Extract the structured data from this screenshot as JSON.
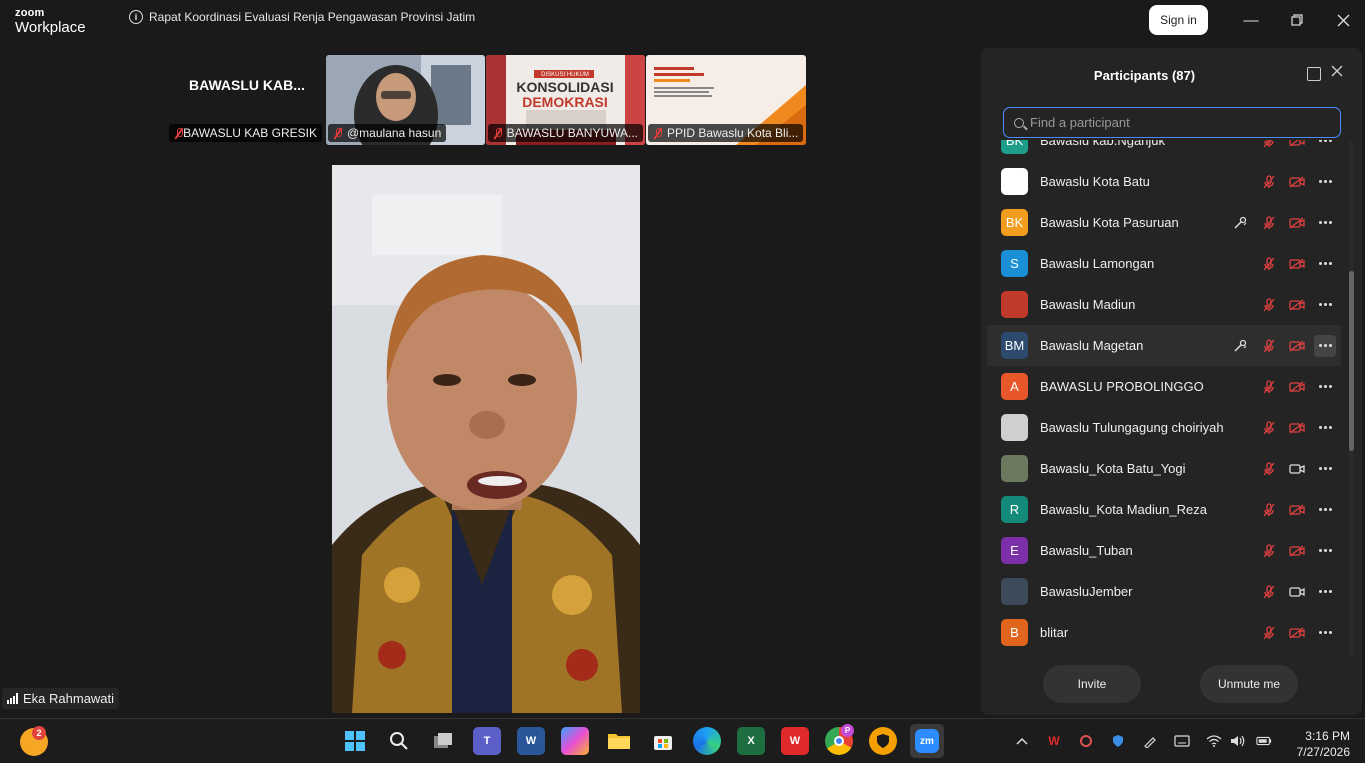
{
  "app": {
    "brand_top": "zoom",
    "brand_bottom": "Workplace",
    "meeting_title": "Rapat Koordinasi Evaluasi Renja Pengawasan Provinsi Jatim",
    "signin_label": "Sign in"
  },
  "gallery": {
    "name_tile": {
      "display_name": "BAWASLU KAB...",
      "label": "BAWASLU KAB GRESIK"
    },
    "tiles": [
      {
        "label": "@maulana hasun"
      },
      {
        "label": "BAWASLU BANYUWA..."
      },
      {
        "label": "PPID Bawaslu Kota Bli..."
      }
    ],
    "banner_top": "DISKUSI HUKUM",
    "banner_main1": "KONSOLIDASI",
    "banner_main2": "DEMOKRASI"
  },
  "speaker": {
    "name": "Eka Rahmawati"
  },
  "participants": {
    "title": "Participants (87)",
    "search_placeholder": "Find a participant",
    "list": [
      {
        "name": "Bawaslu kab.Nganjuk",
        "initials": "BK",
        "color": "#1e9e8a",
        "raise": false,
        "video": "off"
      },
      {
        "name": "Bawaslu Kota Batu",
        "initials": "",
        "color": "#ffffff",
        "raise": false,
        "video": "off"
      },
      {
        "name": "Bawaslu Kota Pasuruan",
        "initials": "BK",
        "color": "#f29d1e",
        "raise": true,
        "video": "off"
      },
      {
        "name": "Bawaslu Lamongan",
        "initials": "S",
        "color": "#1a8fd6",
        "raise": false,
        "video": "off"
      },
      {
        "name": "Bawaslu Madiun",
        "initials": "",
        "color": "#c0392b",
        "raise": false,
        "video": "off"
      },
      {
        "name": "Bawaslu Magetan",
        "initials": "BM",
        "color": "#2c4a6e",
        "raise": true,
        "video": "off"
      },
      {
        "name": "BAWASLU PROBOLINGGO",
        "initials": "A",
        "color": "#e8572a",
        "raise": false,
        "video": "off"
      },
      {
        "name": "Bawaslu Tulungagung choiriyah",
        "initials": "",
        "color": "#cfcfcf",
        "raise": false,
        "video": "off"
      },
      {
        "name": "Bawaslu_Kota Batu_Yogi",
        "initials": "",
        "color": "#6b7a5e",
        "raise": false,
        "video": "on"
      },
      {
        "name": "Bawaslu_Kota Madiun_Reza",
        "initials": "R",
        "color": "#148a7a",
        "raise": false,
        "video": "off"
      },
      {
        "name": "Bawaslu_Tuban",
        "initials": "E",
        "color": "#7b2fa8",
        "raise": false,
        "video": "off"
      },
      {
        "name": "BawasluJember",
        "initials": "",
        "color": "#3c4a5a",
        "raise": false,
        "video": "on"
      },
      {
        "name": "blitar",
        "initials": "B",
        "color": "#e0661e",
        "raise": false,
        "video": "off"
      }
    ],
    "invite_label": "Invite",
    "unmute_label": "Unmute me"
  },
  "taskbar": {
    "notif_count": "2",
    "chrome_badge": "P",
    "time": "3:16 PM",
    "date": "7/27/2026"
  }
}
